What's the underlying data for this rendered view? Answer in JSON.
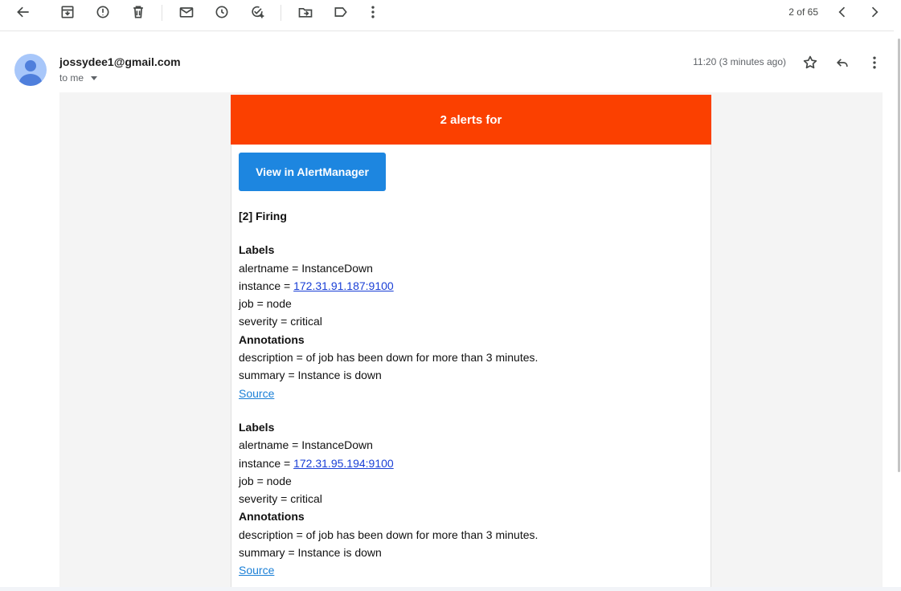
{
  "toolbar": {
    "back": "back-arrow-icon",
    "archive": "archive-icon",
    "spam": "report-spam-icon",
    "delete": "trash-icon",
    "mark_unread": "mail-icon",
    "snooze": "clock-icon",
    "add_task": "add-task-icon",
    "move_to": "move-to-folder-icon",
    "labels": "label-icon",
    "more": "more-vert-icon",
    "pager": "2 of 65"
  },
  "message": {
    "sender": "jossydee1@gmail.com",
    "recipient": "to me",
    "time": "11:20 (3 minutes ago)"
  },
  "email": {
    "banner_title": "2 alerts for",
    "button_label": "View in AlertManager",
    "firing_heading": "[2] Firing",
    "alerts": [
      {
        "labels_heading": "Labels",
        "alertname": "alertname = InstanceDown",
        "instance_prefix": "instance = ",
        "instance_link": "172.31.91.187:9100",
        "job": "job = node",
        "severity": "severity = critical",
        "annotations_heading": "Annotations",
        "description": "description = of job has been down for more than 3 minutes.",
        "summary": "summary = Instance is down",
        "source_link": "Source"
      },
      {
        "labels_heading": "Labels",
        "alertname": "alertname = InstanceDown",
        "instance_prefix": "instance = ",
        "instance_link": "172.31.95.194:9100",
        "job": "job = node",
        "severity": "severity = critical",
        "annotations_heading": "Annotations",
        "description": "description = of job has been down for more than 3 minutes.",
        "summary": "summary = Instance is down",
        "source_link": "Source"
      }
    ]
  },
  "colors": {
    "banner": "#fb4000",
    "button": "#1d86e0",
    "link": "#1a3fd6"
  }
}
